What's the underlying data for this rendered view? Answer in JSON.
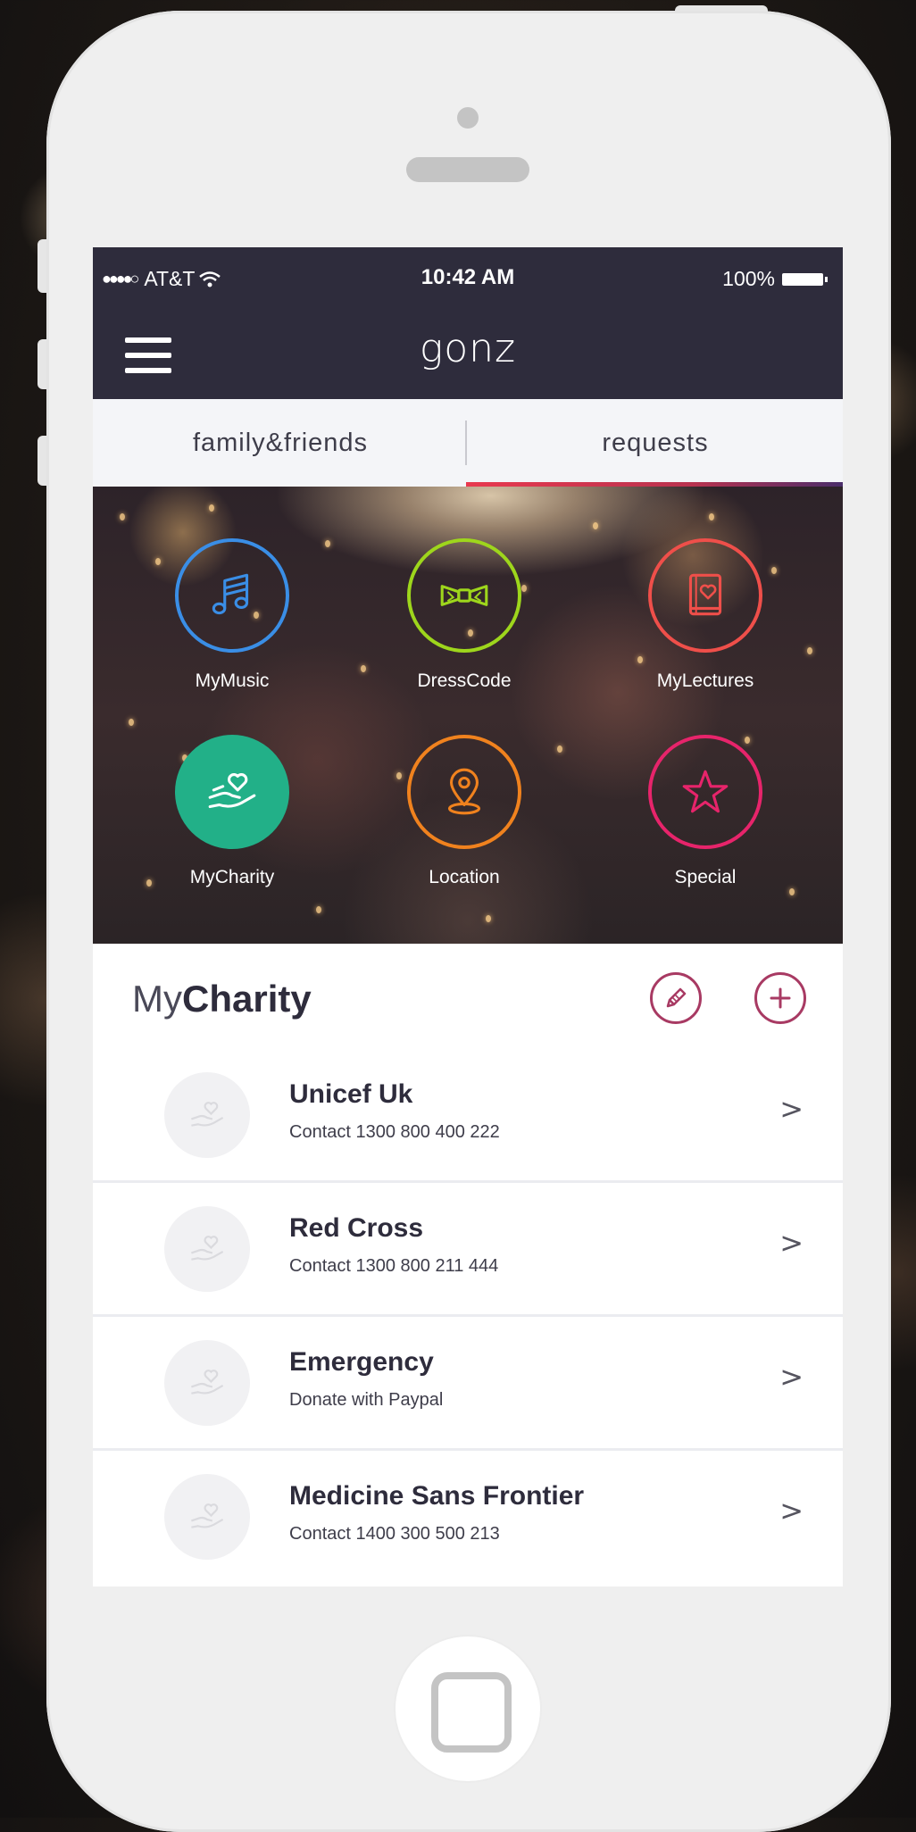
{
  "status_bar": {
    "signal": "●●●●○",
    "carrier": "AT&T",
    "time": "10:42 AM",
    "battery": "100%"
  },
  "header": {
    "title": "gonz",
    "menu_icon": "hamburger-menu-icon"
  },
  "tabs": [
    {
      "label": "family&friends",
      "active": false
    },
    {
      "label": "requests",
      "active": true
    }
  ],
  "hero_grid": [
    {
      "label": "MyMusic",
      "icon": "music-note-icon",
      "color": "#3a8ee6",
      "filled": false
    },
    {
      "label": "DressCode",
      "icon": "bow-tie-icon",
      "color": "#9ed61c",
      "filled": false
    },
    {
      "label": "MyLectures",
      "icon": "book-heart-icon",
      "color": "#ef4f4a",
      "filled": false
    },
    {
      "label": "MyCharity",
      "icon": "hand-heart-icon",
      "color": "#22b088",
      "filled": true
    },
    {
      "label": "Location",
      "icon": "map-pin-icon",
      "color": "#f0821e",
      "filled": false
    },
    {
      "label": "Special",
      "icon": "star-icon",
      "color": "#e7246b",
      "filled": false
    }
  ],
  "charity": {
    "title_light": "My",
    "title_bold": "Charity",
    "edit_icon": "pencil-icon",
    "add_icon": "plus-icon",
    "accent_color": "#a83a63",
    "items": [
      {
        "name": "Unicef Uk",
        "detail": "Contact 1300 800 400 222",
        "chevron": ">"
      },
      {
        "name": "Red Cross",
        "detail": "Contact 1300 800 211 444",
        "chevron": ">"
      },
      {
        "name": "Emergency",
        "detail": "Donate with Paypal",
        "chevron": ">"
      },
      {
        "name": "Medicine Sans Frontier",
        "detail": "Contact 1400 300 500 213",
        "chevron": ">"
      }
    ]
  }
}
